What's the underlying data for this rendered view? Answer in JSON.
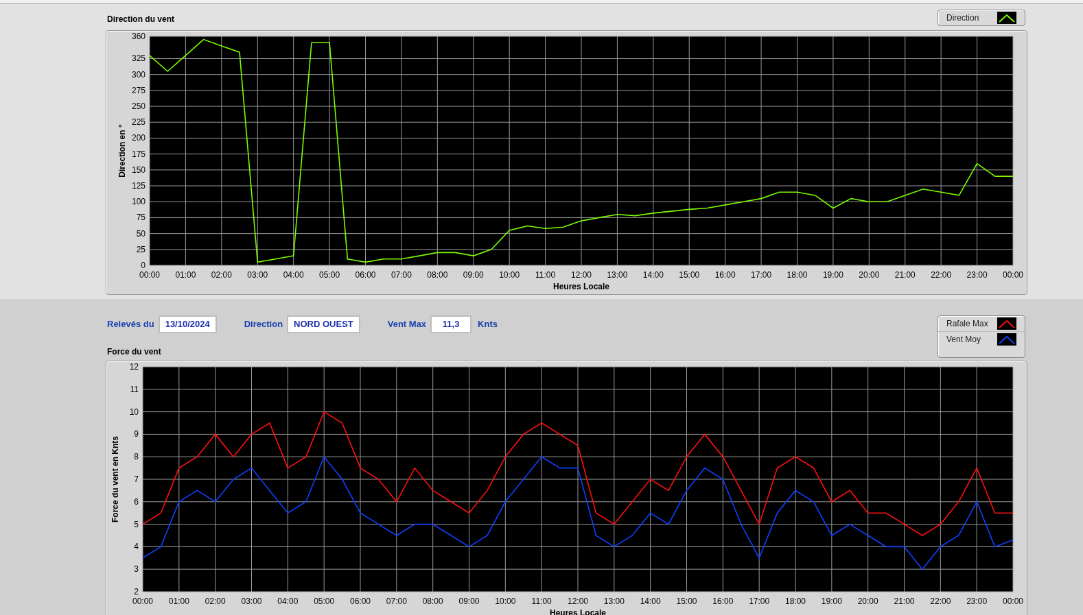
{
  "direction_chart": {
    "title": "Direction du vent",
    "chart_data": {
      "type": "line",
      "grid": true,
      "xlabel": "Heures Locale",
      "ylabel": "Direction en °",
      "xlim": [
        0,
        24
      ],
      "ylim": [
        0,
        360
      ],
      "x": [
        0,
        0.5,
        1,
        1.5,
        2,
        2.5,
        3,
        3.5,
        4,
        4.5,
        5,
        5.5,
        6,
        6.5,
        7,
        7.5,
        8,
        8.5,
        9,
        9.5,
        10,
        10.5,
        11,
        11.5,
        12,
        12.5,
        13,
        13.5,
        14,
        14.5,
        15,
        15.5,
        16,
        16.5,
        17,
        17.5,
        18,
        18.5,
        19,
        19.5,
        20,
        20.5,
        21,
        21.5,
        22,
        22.5,
        23,
        23.5,
        24
      ],
      "series": [
        {
          "name": "Direction",
          "color": "#7cfc00",
          "values": [
            330,
            305,
            330,
            355,
            345,
            335,
            5,
            10,
            15,
            350,
            350,
            10,
            5,
            10,
            10,
            15,
            20,
            20,
            15,
            25,
            55,
            62,
            58,
            60,
            70,
            75,
            80,
            78,
            82,
            85,
            88,
            90,
            95,
            100,
            105,
            115,
            115,
            110,
            90,
            105,
            100,
            100,
            110,
            120,
            115,
            110,
            160,
            140,
            140
          ]
        }
      ],
      "xticks": [
        {
          "value": 0,
          "label": "00:00"
        },
        {
          "value": 1,
          "label": "01:00"
        },
        {
          "value": 2,
          "label": "02:00"
        },
        {
          "value": 3,
          "label": "03:00"
        },
        {
          "value": 4,
          "label": "04:00"
        },
        {
          "value": 5,
          "label": "05:00"
        },
        {
          "value": 6,
          "label": "06:00"
        },
        {
          "value": 7,
          "label": "07:00"
        },
        {
          "value": 8,
          "label": "08:00"
        },
        {
          "value": 9,
          "label": "09:00"
        },
        {
          "value": 10,
          "label": "10:00"
        },
        {
          "value": 11,
          "label": "11:00"
        },
        {
          "value": 12,
          "label": "12:00"
        },
        {
          "value": 13,
          "label": "13:00"
        },
        {
          "value": 14,
          "label": "14:00"
        },
        {
          "value": 15,
          "label": "15:00"
        },
        {
          "value": 16,
          "label": "16:00"
        },
        {
          "value": 17,
          "label": "17:00"
        },
        {
          "value": 18,
          "label": "18:00"
        },
        {
          "value": 19,
          "label": "19:00"
        },
        {
          "value": 20,
          "label": "20:00"
        },
        {
          "value": 21,
          "label": "21:00"
        },
        {
          "value": 22,
          "label": "22:00"
        },
        {
          "value": 23,
          "label": "23:00"
        },
        {
          "value": 24,
          "label": "00:00"
        }
      ],
      "yticks": [
        0,
        25,
        50,
        75,
        100,
        125,
        150,
        175,
        200,
        225,
        250,
        275,
        300,
        325,
        360
      ]
    }
  },
  "readings": [
    {
      "label": "Relevés du",
      "value": "13/10/2024"
    },
    {
      "label": "Direction",
      "value": "NORD OUEST"
    },
    {
      "label": "Vent Max",
      "value": "11,3",
      "unit": "Knts"
    }
  ],
  "force_chart": {
    "title": "Force du vent",
    "chart_data": {
      "type": "line",
      "grid": true,
      "xlabel": "Heures Locale",
      "ylabel": "Force du vent en Knts",
      "xlim": [
        0,
        24
      ],
      "ylim": [
        2,
        12
      ],
      "x": [
        0,
        0.5,
        1,
        1.5,
        2,
        2.5,
        3,
        3.5,
        4,
        4.5,
        5,
        5.5,
        6,
        6.5,
        7,
        7.5,
        8,
        8.5,
        9,
        9.5,
        10,
        10.5,
        11,
        11.5,
        12,
        12.5,
        13,
        13.5,
        14,
        14.5,
        15,
        15.5,
        16,
        16.5,
        17,
        17.5,
        18,
        18.5,
        19,
        19.5,
        20,
        20.5,
        21,
        21.5,
        22,
        22.5,
        23,
        23.5,
        24
      ],
      "series": [
        {
          "name": "Rafale Max",
          "color": "#ff1010",
          "values": [
            5,
            5.5,
            7.5,
            8,
            9,
            8,
            9,
            9.5,
            7.5,
            8,
            10,
            9.5,
            7.5,
            7,
            6,
            7.5,
            6.5,
            6,
            5.5,
            6.5,
            8,
            9,
            9.5,
            9,
            8.5,
            5.5,
            5,
            6,
            7,
            6.5,
            8,
            9,
            8,
            6.5,
            5,
            7.5,
            8,
            7.5,
            6,
            6.5,
            5.5,
            5.5,
            5,
            4.5,
            5,
            6,
            7.5,
            5.5,
            5.5
          ]
        },
        {
          "name": "Vent Moy",
          "color": "#1040ff",
          "values": [
            3.5,
            4,
            6,
            6.5,
            6,
            7,
            7.5,
            6.5,
            5.5,
            6,
            8,
            7,
            5.5,
            5,
            4.5,
            5,
            5,
            4.5,
            4,
            4.5,
            6,
            7,
            8,
            7.5,
            7.5,
            4.5,
            4,
            4.5,
            5.5,
            5,
            6.5,
            7.5,
            7,
            5,
            3.5,
            5.5,
            6.5,
            6,
            4.5,
            5,
            4.5,
            4,
            4,
            3,
            4,
            4.5,
            6,
            4,
            4.3
          ]
        }
      ],
      "xticks": [
        {
          "value": 0,
          "label": "00:00"
        },
        {
          "value": 1,
          "label": "01:00"
        },
        {
          "value": 2,
          "label": "02:00"
        },
        {
          "value": 3,
          "label": "03:00"
        },
        {
          "value": 4,
          "label": "04:00"
        },
        {
          "value": 5,
          "label": "05:00"
        },
        {
          "value": 6,
          "label": "06:00"
        },
        {
          "value": 7,
          "label": "07:00"
        },
        {
          "value": 8,
          "label": "08:00"
        },
        {
          "value": 9,
          "label": "09:00"
        },
        {
          "value": 10,
          "label": "10:00"
        },
        {
          "value": 11,
          "label": "11:00"
        },
        {
          "value": 12,
          "label": "12:00"
        },
        {
          "value": 13,
          "label": "13:00"
        },
        {
          "value": 14,
          "label": "14:00"
        },
        {
          "value": 15,
          "label": "15:00"
        },
        {
          "value": 16,
          "label": "16:00"
        },
        {
          "value": 17,
          "label": "17:00"
        },
        {
          "value": 18,
          "label": "18:00"
        },
        {
          "value": 19,
          "label": "19:00"
        },
        {
          "value": 20,
          "label": "20:00"
        },
        {
          "value": 21,
          "label": "21:00"
        },
        {
          "value": 22,
          "label": "22:00"
        },
        {
          "value": 23,
          "label": "23:00"
        },
        {
          "value": 24,
          "label": "00:00"
        }
      ],
      "yticks": [
        2,
        3,
        4,
        5,
        6,
        7,
        8,
        9,
        10,
        11,
        12
      ]
    }
  }
}
